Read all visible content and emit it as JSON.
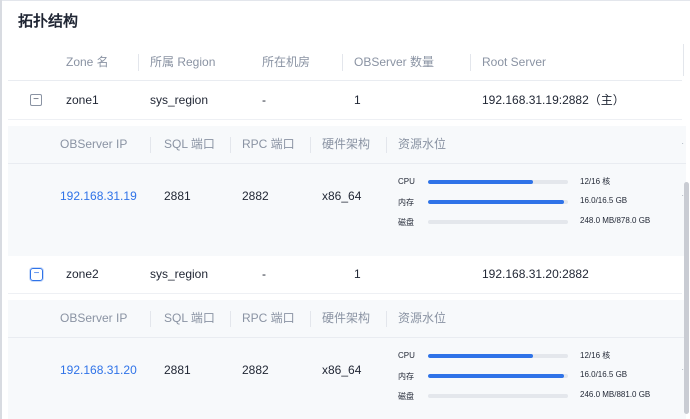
{
  "title": "拓扑结构",
  "zone_columns": [
    "Zone 名",
    "所属 Region",
    "所在机房",
    "OBServer 数量",
    "Root Server"
  ],
  "detail_columns": [
    "OBServer IP",
    "SQL 端口",
    "RPC 端口",
    "硬件架构",
    "资源水位"
  ],
  "zones": [
    {
      "toggle": "−",
      "name": "zone1",
      "region": "sys_region",
      "idc": "-",
      "count": "1",
      "root": "192.168.31.19:2882（主）",
      "servers": [
        {
          "ip": "192.168.31.19",
          "sql_port": "2881",
          "rpc_port": "2882",
          "arch": "x86_64",
          "resources": [
            {
              "label": "CPU",
              "value": "12/16 核",
              "fill": 0.75
            },
            {
              "label": "内存",
              "value": "16.0/16.5 GB",
              "fill": 0.97
            },
            {
              "label": "磁盘",
              "value": "248.0 MB/878.0 GB",
              "fill": 0.0
            }
          ]
        }
      ]
    },
    {
      "toggle": "−",
      "name": "zone2",
      "region": "sys_region",
      "idc": "-",
      "count": "1",
      "root": "192.168.31.20:2882",
      "servers": [
        {
          "ip": "192.168.31.20",
          "sql_port": "2881",
          "rpc_port": "2882",
          "arch": "x86_64",
          "resources": [
            {
              "label": "CPU",
              "value": "12/16 核",
              "fill": 0.75
            },
            {
              "label": "内存",
              "value": "16.0/16.5 GB",
              "fill": 0.97
            },
            {
              "label": "磁盘",
              "value": "246.0 MB/881.0 GB",
              "fill": 0.0
            }
          ]
        }
      ]
    }
  ],
  "colors": {
    "accent": "#2f73e8",
    "bar_track": "#e4e7ec",
    "detail_bg": "#f7f9fb"
  }
}
